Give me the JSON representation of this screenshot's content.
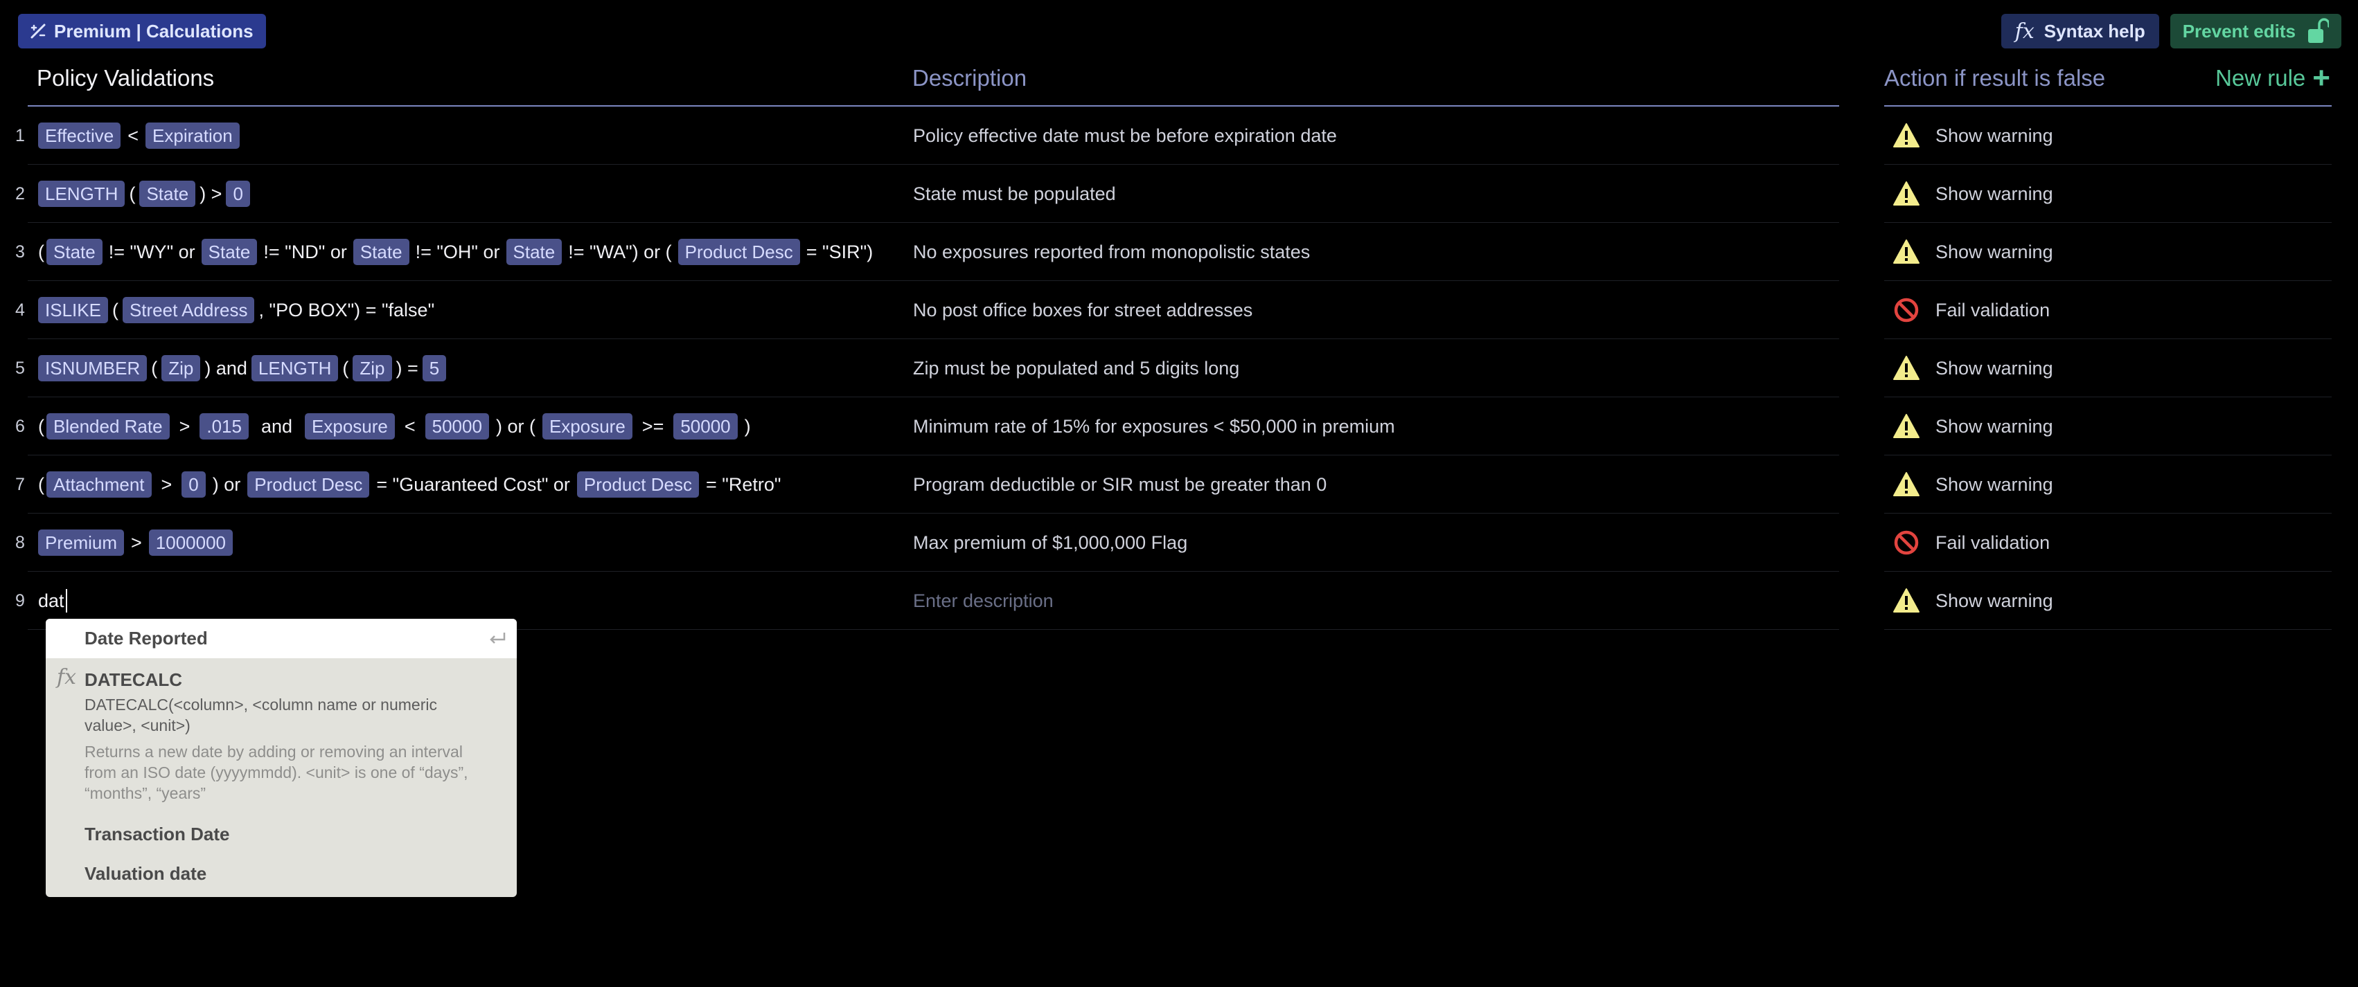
{
  "header": {
    "breadcrumb": "Premium | Calculations",
    "syntax_help": "Syntax help",
    "prevent_edits": "Prevent edits"
  },
  "columns": {
    "policy": "Policy Validations",
    "description": "Description",
    "action": "Action if result is false",
    "new_rule": "New rule"
  },
  "rows": [
    {
      "num": "1",
      "description": "Policy effective date must be before expiration date",
      "action": "Show warning"
    },
    {
      "num": "2",
      "description": "State must be populated",
      "action": "Show warning"
    },
    {
      "num": "3",
      "description": "No exposures reported from monopolistic states",
      "action": "Show warning"
    },
    {
      "num": "4",
      "description": "No post office boxes for street addresses",
      "action": "Fail validation"
    },
    {
      "num": "5",
      "description": "Zip must be populated and 5 digits long",
      "action": "Show warning"
    },
    {
      "num": "6",
      "description": "Minimum rate of 15% for exposures < $50,000 in premium",
      "action": "Show warning"
    },
    {
      "num": "7",
      "description": "Program deductible or SIR must be greater than 0",
      "action": "Show warning"
    },
    {
      "num": "8",
      "description": "Max premium of $1,000,000 Flag",
      "action": "Fail validation"
    },
    {
      "num": "9",
      "description_placeholder": "Enter description",
      "typed": "dat",
      "action": "Show warning"
    }
  ],
  "expressions": {
    "r1": [
      "Effective",
      "<",
      "Expiration"
    ],
    "r2": [
      "LENGTH",
      "(",
      "State",
      ") >",
      "0"
    ],
    "r3": [
      "(",
      "State",
      "!= \"WY\" or",
      "State",
      "!= \"ND\" or",
      "State",
      "!= \"OH\" or",
      "State",
      "!= \"WA\") or (",
      "Product Desc",
      "= \"SIR\")"
    ],
    "r4": [
      "ISLIKE",
      "(",
      "Street Address",
      ", \"PO BOX\") = \"false\""
    ],
    "r5": [
      "ISNUMBER",
      "(",
      "Zip",
      ") and",
      "LENGTH",
      "(",
      "Zip",
      ") =",
      "5"
    ],
    "r6": [
      "(",
      "Blended Rate",
      ">",
      ".015",
      "and",
      "Exposure",
      "<",
      "50000",
      ") or (",
      "Exposure",
      ">=",
      "50000",
      ")"
    ],
    "r7": [
      "(",
      "Attachment",
      ">",
      "0",
      ") or",
      "Product Desc",
      "= \"Guaranteed Cost\" or",
      "Product Desc",
      "= \"Retro\""
    ],
    "r8": [
      "Premium",
      ">",
      "1000000"
    ]
  },
  "autocomplete": {
    "items": [
      {
        "label": "Date Reported"
      },
      {
        "label": "DATECALC",
        "signature": "DATECALC(<column>, <column name or numeric value>, <unit>)",
        "doc": "Returns a new date by adding or removing an interval from an ISO date (yyyymmdd). <unit> is one of “days”, “months”, “years”"
      },
      {
        "label": "Transaction Date"
      },
      {
        "label": "Valuation date"
      }
    ]
  },
  "icons": {
    "warning": "warning-triangle-icon",
    "fail": "prohibited-icon",
    "breadcrumb": "calculator-icon",
    "lock": "unlock-icon"
  },
  "colors": {
    "background": "#000000",
    "token": "#4a5189",
    "accent_green": "#58c99a",
    "warning_yellow": "#f3ec8c",
    "fail_red": "#e2443f"
  }
}
